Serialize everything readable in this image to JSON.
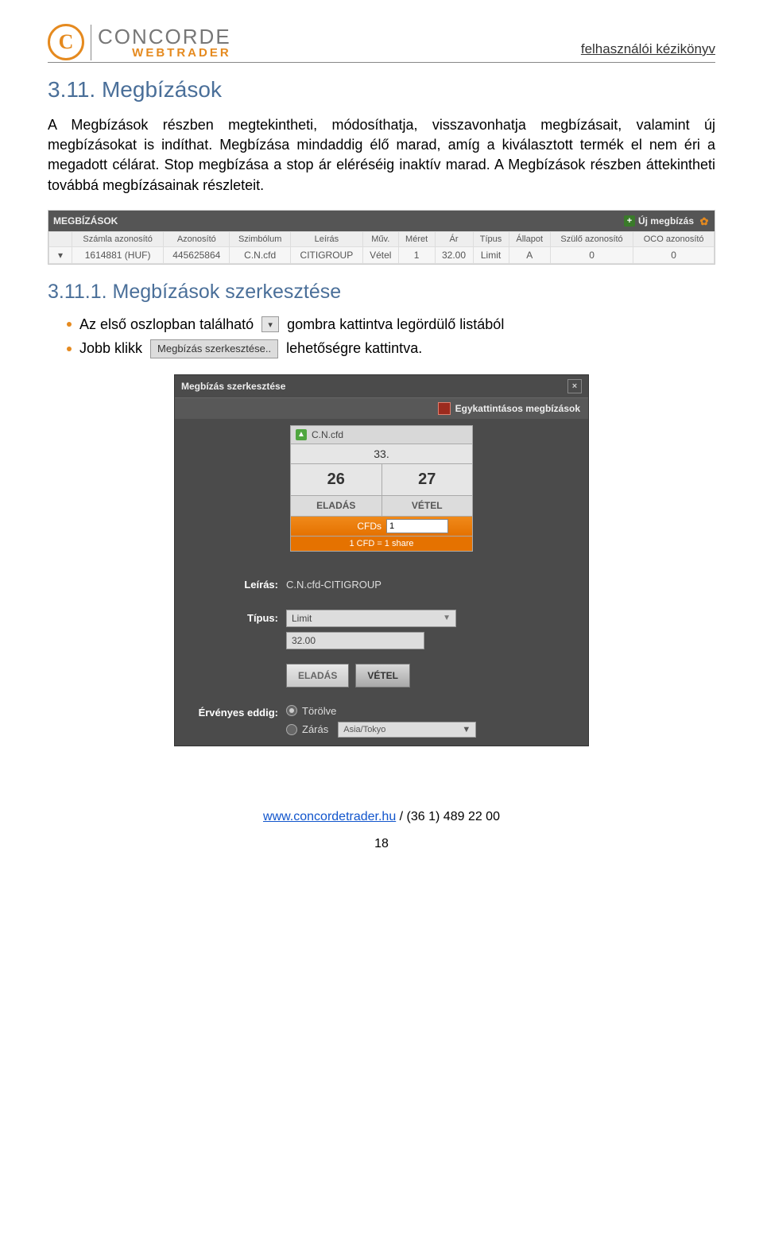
{
  "header": {
    "brand": "CONCORDE",
    "sub": "WEBTRADER",
    "right": "felhasználói kézikönyv"
  },
  "h1": "3.11. Megbízások",
  "para": "A Megbízások részben megtekintheti, módosíthatja, visszavonhatja megbízásait, valamint új megbízásokat is indíthat. Megbízása mindaddig élő marad, amíg a kiválasztott termék el nem éri a megadott célárat. Stop megbízása a stop ár eléréséig inaktív marad. A Megbízások részben áttekintheti továbbá megbízásainak részleteit.",
  "shot1": {
    "title": "MEGBÍZÁSOK",
    "new": "Új megbízás",
    "cols": [
      "Számla azonosító",
      "Azonosító",
      "Szimbólum",
      "Leírás",
      "Műv.",
      "Méret",
      "Ár",
      "Típus",
      "Állapot",
      "Szülő azonosító",
      "OCO azonosító"
    ],
    "row": [
      "1614881 (HUF)",
      "445625864",
      "C.N.cfd",
      "CITIGROUP",
      "Vétel",
      "1",
      "32.00",
      "Limit",
      "A",
      "0",
      "0"
    ]
  },
  "h2": "3.11.1. Megbízások szerkesztése",
  "b1a": "Az első oszlopban található",
  "b1b": "gombra kattintva legördülő listából",
  "b2a": "Jobb klikk",
  "b2_btn": "Megbízás szerkesztése..",
  "b2b": "lehetőségre kattintva.",
  "shot2": {
    "title": "Megbízás szerkesztése",
    "subbar": "Egykattintásos megbízások",
    "symbol": "C.N.cfd",
    "big": "33.",
    "bid": "26",
    "ask": "27",
    "sell": "ELADÁS",
    "buy": "VÉTEL",
    "cfds_label": "CFDs",
    "cfds_value": "1",
    "note": "1 CFD = 1 share",
    "desc_label": "Leírás:",
    "desc_value": "C.N.cfd-CITIGROUP",
    "type_label": "Típus:",
    "type_value": "Limit",
    "price": "32.00",
    "btn_sell": "ELADÁS",
    "btn_buy": "VÉTEL",
    "valid_label": "Érvényes eddig:",
    "opt_deleted": "Törölve",
    "opt_close": "Zárás",
    "tz": "Asia/Tokyo"
  },
  "footer": {
    "url": "www.concordetrader.hu",
    "phone": " / (36 1) 489 22 00",
    "page": "18"
  }
}
